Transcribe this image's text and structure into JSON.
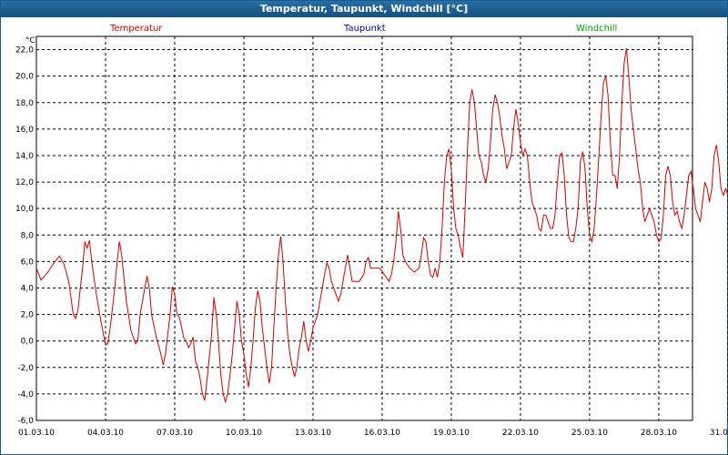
{
  "window": {
    "title": "Temperatur, Taupunkt, Windchill [°C]"
  },
  "chart_data": {
    "type": "line",
    "y_unit": "°C",
    "ylim": [
      -6,
      23
    ],
    "y_ticks": [
      "22,0",
      "20,0",
      "18,0",
      "16,0",
      "14,0",
      "12,0",
      "10,0",
      "8,0",
      "6,0",
      "4,0",
      "2,0",
      "0,0",
      "-2,0",
      "-4,0",
      "-6,0"
    ],
    "x_ticks": [
      "01.03.10",
      "04.03.10",
      "07.03.10",
      "10.03.10",
      "13.03.10",
      "16.03.10",
      "19.03.10",
      "22.03.10",
      "25.03.10",
      "28.03.10",
      "31.03.10"
    ],
    "grid": true,
    "legend": [
      {
        "name": "Temperatur",
        "color": "#d40000"
      },
      {
        "name": "Taupunkt",
        "color": "#0000c8"
      },
      {
        "name": "Windchill",
        "color": "#00a000"
      }
    ],
    "series": [
      {
        "name": "Temperatur",
        "color": "#d40000",
        "points": [
          [
            0,
            5.5
          ],
          [
            0.2,
            4.6
          ],
          [
            0.5,
            5.2
          ],
          [
            0.8,
            6.0
          ],
          [
            1.0,
            6.4
          ],
          [
            1.2,
            5.8
          ],
          [
            1.4,
            4.5
          ],
          [
            1.6,
            2.0
          ],
          [
            1.7,
            1.7
          ],
          [
            1.8,
            2.3
          ],
          [
            2.0,
            5.5
          ],
          [
            2.1,
            7.5
          ],
          [
            2.2,
            7.0
          ],
          [
            2.3,
            7.6
          ],
          [
            2.4,
            6.0
          ],
          [
            2.6,
            3.5
          ],
          [
            2.8,
            1.5
          ],
          [
            3.0,
            -0.3
          ],
          [
            3.1,
            -0.2
          ],
          [
            3.2,
            1.0
          ],
          [
            3.4,
            4.0
          ],
          [
            3.5,
            6.0
          ],
          [
            3.6,
            7.5
          ],
          [
            3.7,
            6.5
          ],
          [
            3.9,
            3.0
          ],
          [
            4.1,
            0.8
          ],
          [
            4.3,
            -0.2
          ],
          [
            4.4,
            0.0
          ],
          [
            4.5,
            2.0
          ],
          [
            4.7,
            4.0
          ],
          [
            4.8,
            4.9
          ],
          [
            4.9,
            4.0
          ],
          [
            5.0,
            2.0
          ],
          [
            5.2,
            0.3
          ],
          [
            5.4,
            -1.0
          ],
          [
            5.5,
            -1.8
          ],
          [
            5.6,
            -1.0
          ],
          [
            5.8,
            2.0
          ],
          [
            5.9,
            4.1
          ],
          [
            6.0,
            3.5
          ],
          [
            6.1,
            2.0
          ],
          [
            6.2,
            1.8
          ],
          [
            6.3,
            1.0
          ],
          [
            6.4,
            0.2
          ],
          [
            6.5,
            0.0
          ],
          [
            6.6,
            -0.5
          ],
          [
            6.7,
            -0.2
          ],
          [
            6.8,
            0.3
          ],
          [
            6.9,
            -1.5
          ],
          [
            7.0,
            -2.0
          ],
          [
            7.1,
            -2.8
          ],
          [
            7.2,
            -4.0
          ],
          [
            7.3,
            -4.5
          ],
          [
            7.4,
            -3.0
          ],
          [
            7.6,
            0.5
          ],
          [
            7.7,
            3.3
          ],
          [
            7.8,
            2.0
          ],
          [
            7.9,
            0.0
          ],
          [
            8.0,
            -2.5
          ],
          [
            8.1,
            -4.0
          ],
          [
            8.2,
            -4.6
          ],
          [
            8.3,
            -4.0
          ],
          [
            8.4,
            -2.5
          ],
          [
            8.5,
            -1.0
          ],
          [
            8.6,
            1.0
          ],
          [
            8.7,
            3.0
          ],
          [
            8.8,
            2.0
          ],
          [
            8.9,
            0.0
          ],
          [
            9.0,
            -1.0
          ],
          [
            9.1,
            -2.5
          ],
          [
            9.2,
            -3.5
          ],
          [
            9.3,
            -2.0
          ],
          [
            9.4,
            0.0
          ],
          [
            9.5,
            2.5
          ],
          [
            9.6,
            3.8
          ],
          [
            9.7,
            3.0
          ],
          [
            9.8,
            1.0
          ],
          [
            9.9,
            -0.5
          ],
          [
            10.0,
            -2.0
          ],
          [
            10.1,
            -3.2
          ],
          [
            10.2,
            -2.0
          ],
          [
            10.3,
            1.0
          ],
          [
            10.4,
            4.0
          ],
          [
            10.5,
            6.5
          ],
          [
            10.6,
            7.9
          ],
          [
            10.7,
            6.0
          ],
          [
            10.8,
            3.0
          ],
          [
            10.9,
            0.5
          ],
          [
            11.0,
            -1.0
          ],
          [
            11.1,
            -2.0
          ],
          [
            11.2,
            -2.7
          ],
          [
            11.3,
            -2.0
          ],
          [
            11.4,
            -0.5
          ],
          [
            11.5,
            0.3
          ],
          [
            11.6,
            1.5
          ],
          [
            11.7,
            0.0
          ],
          [
            11.8,
            -0.8
          ],
          [
            11.9,
            0.0
          ],
          [
            12.0,
            1.0
          ],
          [
            12.1,
            1.5
          ],
          [
            12.2,
            2.0
          ],
          [
            12.3,
            3.0
          ],
          [
            12.4,
            4.0
          ],
          [
            12.5,
            5.0
          ],
          [
            12.6,
            5.9
          ],
          [
            12.7,
            5.5
          ],
          [
            12.8,
            4.5
          ],
          [
            12.9,
            4.0
          ],
          [
            13.0,
            3.5
          ],
          [
            13.1,
            3.0
          ],
          [
            13.2,
            3.5
          ],
          [
            13.3,
            4.5
          ],
          [
            13.4,
            5.5
          ],
          [
            13.5,
            6.5
          ],
          [
            13.6,
            5.5
          ],
          [
            13.7,
            4.5
          ],
          [
            13.8,
            4.5
          ],
          [
            14.0,
            4.5
          ],
          [
            14.2,
            5.0
          ],
          [
            14.3,
            6.0
          ],
          [
            14.4,
            6.3
          ],
          [
            14.5,
            5.5
          ],
          [
            14.7,
            5.5
          ],
          [
            14.9,
            5.5
          ],
          [
            15.1,
            5.0
          ],
          [
            15.3,
            4.5
          ],
          [
            15.4,
            5.0
          ],
          [
            15.5,
            6.0
          ],
          [
            15.6,
            7.5
          ],
          [
            15.7,
            9.8
          ],
          [
            15.8,
            8.5
          ],
          [
            15.9,
            6.5
          ],
          [
            16.0,
            6.0
          ],
          [
            16.2,
            5.5
          ],
          [
            16.4,
            5.2
          ],
          [
            16.6,
            5.5
          ],
          [
            16.7,
            6.5
          ],
          [
            16.8,
            7.8
          ],
          [
            16.9,
            7.5
          ],
          [
            17.0,
            6.0
          ],
          [
            17.1,
            5.0
          ],
          [
            17.2,
            4.8
          ],
          [
            17.3,
            5.5
          ],
          [
            17.4,
            4.8
          ],
          [
            17.5,
            6.0
          ],
          [
            17.6,
            8.5
          ],
          [
            17.7,
            12.0
          ],
          [
            17.8,
            14.0
          ],
          [
            17.9,
            14.5
          ],
          [
            18.0,
            13.0
          ],
          [
            18.1,
            10.0
          ],
          [
            18.2,
            8.5
          ],
          [
            18.3,
            8.0
          ],
          [
            18.4,
            7.0
          ],
          [
            18.5,
            6.3
          ],
          [
            18.6,
            10.0
          ],
          [
            18.7,
            14.5
          ],
          [
            18.8,
            18.0
          ],
          [
            18.9,
            19.0
          ],
          [
            19.0,
            18.0
          ],
          [
            19.1,
            16.0
          ],
          [
            19.2,
            14.0
          ],
          [
            19.3,
            13.5
          ],
          [
            19.4,
            12.5
          ],
          [
            19.5,
            12.0
          ],
          [
            19.6,
            13.0
          ],
          [
            19.7,
            15.0
          ],
          [
            19.8,
            17.5
          ],
          [
            19.9,
            18.6
          ],
          [
            20.0,
            18.0
          ],
          [
            20.1,
            17.0
          ],
          [
            20.2,
            15.5
          ],
          [
            20.3,
            14.5
          ],
          [
            20.4,
            13.0
          ],
          [
            20.5,
            13.5
          ],
          [
            20.6,
            14.0
          ],
          [
            20.7,
            16.0
          ],
          [
            20.8,
            17.5
          ],
          [
            20.9,
            16.5
          ],
          [
            21.0,
            15.0
          ],
          [
            21.1,
            14.0
          ],
          [
            21.2,
            14.5
          ],
          [
            21.3,
            14.0
          ],
          [
            21.4,
            12.0
          ],
          [
            21.5,
            10.5
          ],
          [
            21.6,
            10.0
          ],
          [
            21.7,
            9.5
          ],
          [
            21.8,
            8.5
          ],
          [
            21.9,
            8.3
          ],
          [
            22.0,
            9.5
          ],
          [
            22.1,
            9.5
          ],
          [
            22.2,
            9.0
          ],
          [
            22.3,
            8.5
          ],
          [
            22.4,
            8.5
          ],
          [
            22.5,
            9.5
          ],
          [
            22.6,
            12.0
          ],
          [
            22.7,
            14.0
          ],
          [
            22.8,
            14.2
          ],
          [
            22.9,
            12.5
          ],
          [
            23.0,
            9.5
          ],
          [
            23.1,
            7.8
          ],
          [
            23.2,
            7.5
          ],
          [
            23.3,
            7.5
          ],
          [
            23.4,
            8.5
          ],
          [
            23.5,
            10.0
          ],
          [
            23.6,
            13.5
          ],
          [
            23.7,
            14.3
          ],
          [
            23.8,
            13.0
          ],
          [
            23.9,
            10.0
          ],
          [
            24.0,
            8.0
          ],
          [
            24.1,
            7.5
          ],
          [
            24.2,
            8.5
          ],
          [
            24.3,
            11.0
          ],
          [
            24.4,
            14.0
          ],
          [
            24.5,
            17.0
          ],
          [
            24.6,
            19.5
          ],
          [
            24.7,
            20.0
          ],
          [
            24.8,
            18.5
          ],
          [
            24.9,
            15.0
          ],
          [
            25.0,
            12.5
          ],
          [
            25.1,
            12.5
          ],
          [
            25.2,
            11.5
          ],
          [
            25.3,
            14.0
          ],
          [
            25.4,
            18.0
          ],
          [
            25.5,
            21.0
          ],
          [
            25.6,
            22.1
          ],
          [
            25.7,
            20.0
          ],
          [
            25.8,
            17.5
          ],
          [
            25.9,
            16.0
          ],
          [
            26.0,
            14.5
          ],
          [
            26.1,
            13.0
          ],
          [
            26.2,
            12.0
          ],
          [
            26.3,
            10.0
          ],
          [
            26.4,
            9.0
          ],
          [
            26.5,
            9.5
          ],
          [
            26.6,
            10.0
          ],
          [
            26.7,
            9.5
          ],
          [
            26.8,
            9.0
          ],
          [
            26.9,
            8.0
          ],
          [
            27.0,
            7.5
          ],
          [
            27.1,
            7.7
          ],
          [
            27.2,
            9.5
          ],
          [
            27.3,
            12.5
          ],
          [
            27.4,
            13.2
          ],
          [
            27.5,
            12.5
          ],
          [
            27.6,
            10.5
          ],
          [
            27.7,
            9.5
          ],
          [
            27.8,
            9.8
          ],
          [
            27.9,
            9.0
          ],
          [
            28.0,
            8.5
          ],
          [
            28.1,
            9.5
          ],
          [
            28.2,
            11.0
          ],
          [
            28.3,
            12.5
          ],
          [
            28.4,
            12.8
          ],
          [
            28.5,
            11.5
          ],
          [
            28.6,
            10.0
          ],
          [
            28.7,
            9.5
          ],
          [
            28.8,
            9.0
          ],
          [
            28.9,
            10.5
          ],
          [
            29.0,
            12.0
          ],
          [
            29.1,
            11.5
          ],
          [
            29.2,
            10.5
          ],
          [
            29.3,
            11.5
          ],
          [
            29.4,
            14.0
          ],
          [
            29.5,
            14.8
          ],
          [
            29.6,
            13.5
          ],
          [
            29.7,
            11.5
          ],
          [
            29.8,
            11.0
          ],
          [
            29.9,
            11.5
          ],
          [
            30.0,
            11.0
          ],
          [
            30.1,
            11.5
          ],
          [
            30.2,
            14.5
          ],
          [
            30.3,
            17.0
          ],
          [
            30.4,
            16.0
          ],
          [
            30.5,
            12.0
          ],
          [
            30.6,
            8.5
          ],
          [
            30.7,
            6.0
          ],
          [
            30.8,
            5.8
          ],
          [
            30.9,
            6.5
          ],
          [
            31.0,
            8.5
          ],
          [
            31.1,
            11.0
          ],
          [
            31.2,
            11.5
          ],
          [
            31.3,
            10.5
          ],
          [
            31.4,
            8.0
          ],
          [
            31.5,
            6.0
          ],
          [
            31.6,
            5.5
          ],
          [
            31.65,
            5.3
          ]
        ]
      }
    ]
  }
}
